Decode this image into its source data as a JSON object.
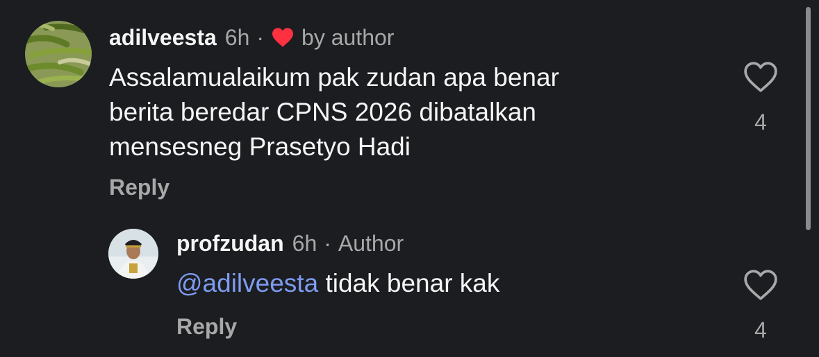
{
  "comment": {
    "username": "adilveesta",
    "time": "6h",
    "dot": "·",
    "liked_by": "by author",
    "lines": [
      "Assalamualaikum pak zudan apa benar",
      "berita beredar CPNS 2026 dibatalkan",
      "mensesneg Prasetyo Hadi"
    ],
    "reply_label": "Reply",
    "like_count": "4",
    "like_icon": "heart-outline-icon",
    "author_like_icon": "heart-filled-icon",
    "author_like_color": "#ff3040"
  },
  "reply": {
    "username": "profzudan",
    "time": "6h",
    "dot": "·",
    "badge": "Author",
    "mention": "@adilveesta",
    "text": " tidak benar kak",
    "reply_label": "Reply",
    "like_count": "4",
    "like_icon": "heart-outline-icon"
  },
  "colors": {
    "background": "#1b1d20",
    "muted_text": "#a8a8a8",
    "mention": "#7e9bf0"
  }
}
